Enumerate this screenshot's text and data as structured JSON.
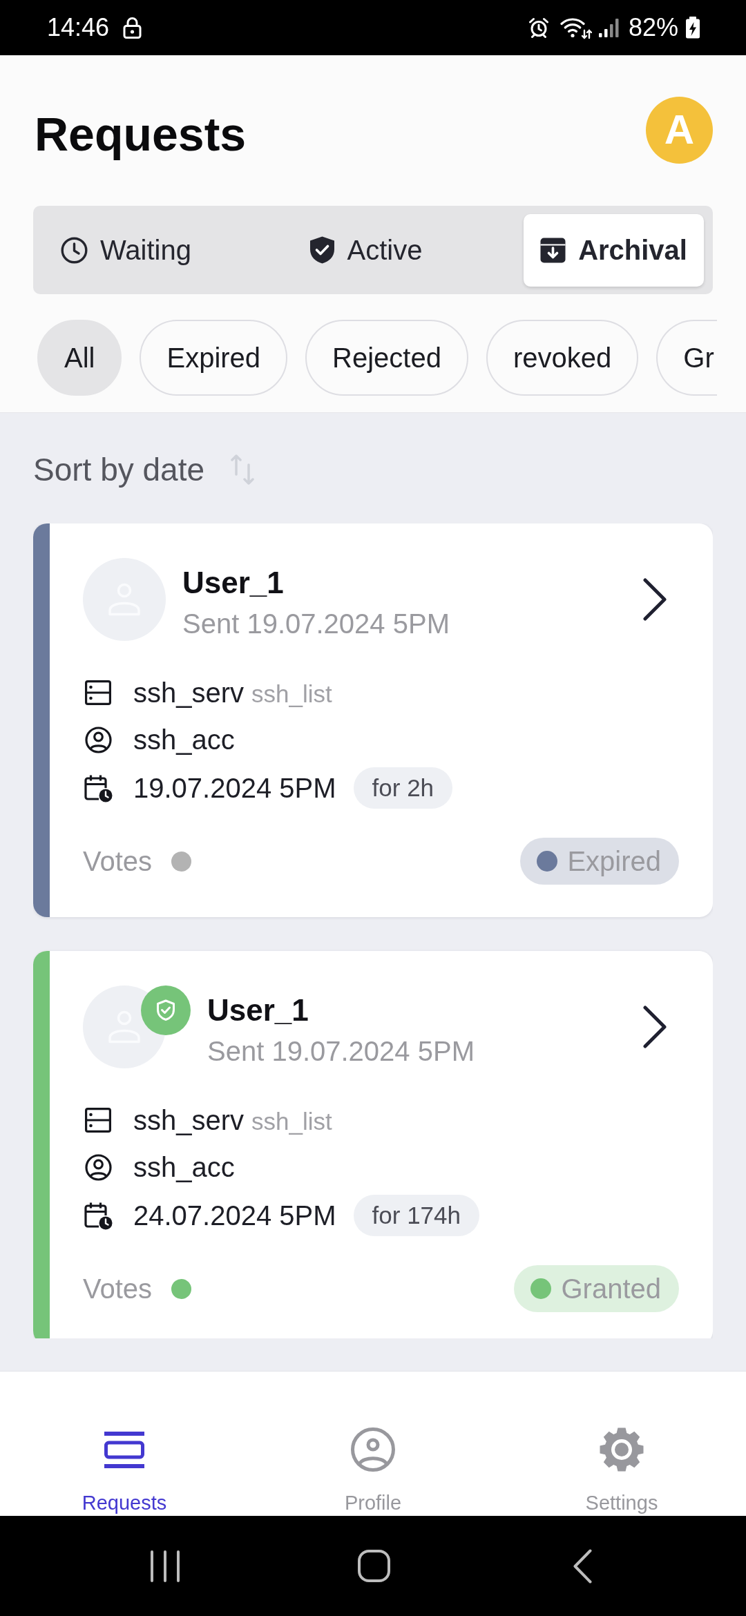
{
  "status_bar": {
    "time": "14:46",
    "battery": "82%"
  },
  "header": {
    "title": "Requests",
    "avatar_initial": "A"
  },
  "tabs": [
    {
      "label": "Waiting",
      "selected": false
    },
    {
      "label": "Active",
      "selected": false
    },
    {
      "label": "Archival",
      "selected": true
    }
  ],
  "filters": [
    {
      "label": "All",
      "selected": true
    },
    {
      "label": "Expired",
      "selected": false
    },
    {
      "label": "Rejected",
      "selected": false
    },
    {
      "label": "revoked",
      "selected": false
    },
    {
      "label": "Gr",
      "selected": false
    }
  ],
  "sort": {
    "label": "Sort by date"
  },
  "requests": [
    {
      "user": "User_1",
      "verified": false,
      "sent": "Sent 19.07.2024 5PM",
      "server": "ssh_serv",
      "server_group": "ssh_list",
      "account": "ssh_acc",
      "date": "19.07.2024 5PM",
      "duration": "for 2h",
      "votes": {
        "label": "Votes",
        "color": "#b3b3b3"
      },
      "status": {
        "label": "Expired",
        "color": "#6b7a9c"
      }
    },
    {
      "user": "User_1",
      "verified": true,
      "sent": "Sent 19.07.2024 5PM",
      "server": "ssh_serv",
      "server_group": "ssh_list",
      "account": "ssh_acc",
      "date": "24.07.2024 5PM",
      "duration": "for 174h",
      "votes": {
        "label": "Votes",
        "color": "#76c479"
      },
      "status": {
        "label": "Granted",
        "color": "#76c479"
      }
    }
  ],
  "bottom_nav": [
    {
      "label": "Requests",
      "selected": true
    },
    {
      "label": "Profile",
      "selected": false
    },
    {
      "label": "Settings",
      "selected": false
    }
  ]
}
